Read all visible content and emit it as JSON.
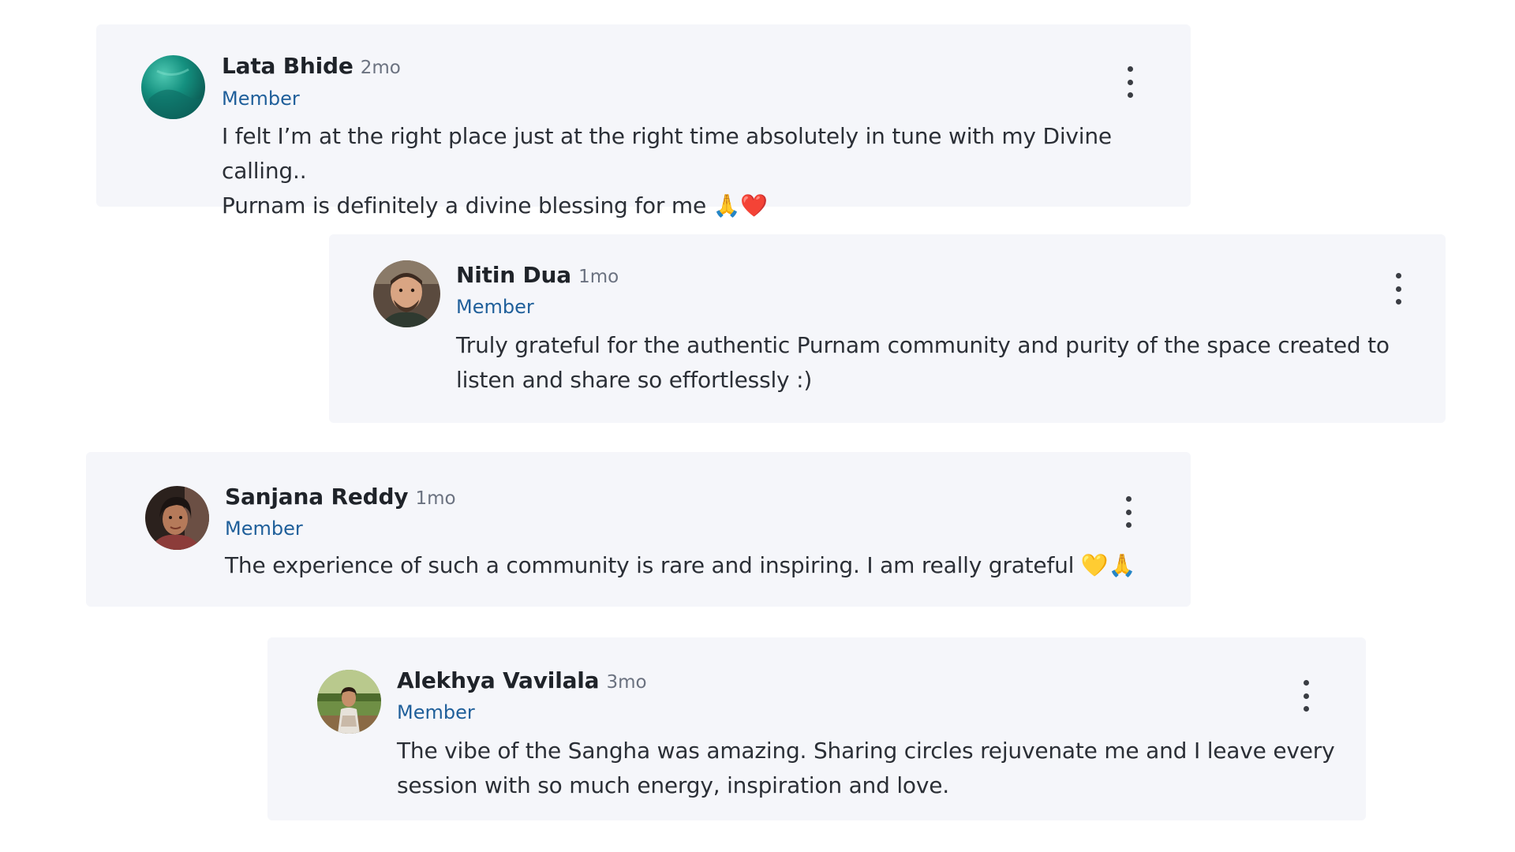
{
  "comments": [
    {
      "name": "Lata Bhide",
      "time": "2mo",
      "role": "Member",
      "text_lines": [
        "I felt I’m at the right place just at the right time absolutely in tune with my Divine calling..",
        "Purnam is definitely a divine blessing for me 🙏❤️"
      ],
      "avatar_icon": "teal-water-avatar"
    },
    {
      "name": "Nitin Dua",
      "time": "1mo",
      "role": "Member",
      "text_lines": [
        "Truly grateful for the authentic Purnam community and purity of the space created to",
        "listen and share so effortlessly :)"
      ],
      "avatar_icon": "man-portrait-avatar"
    },
    {
      "name": "Sanjana Reddy",
      "time": "1mo",
      "role": "Member",
      "text_lines": [
        "The experience of such a community is rare and inspiring. I am really grateful 💛🙏"
      ],
      "avatar_icon": "woman-portrait-avatar"
    },
    {
      "name": "Alekhya Vavilala",
      "time": "3mo",
      "role": "Member",
      "text_lines": [
        "The vibe of the Sangha was amazing. Sharing circles rejuvenate me and I leave every",
        "session with so much energy, inspiration and love."
      ],
      "avatar_icon": "woman-outdoor-avatar"
    }
  ],
  "colors": {
    "card_background": "#f5f6fa",
    "role_link": "#1f5f9a",
    "menu_dots": "#3a3d43"
  },
  "icons": {
    "more_menu": "more-vertical-icon"
  }
}
